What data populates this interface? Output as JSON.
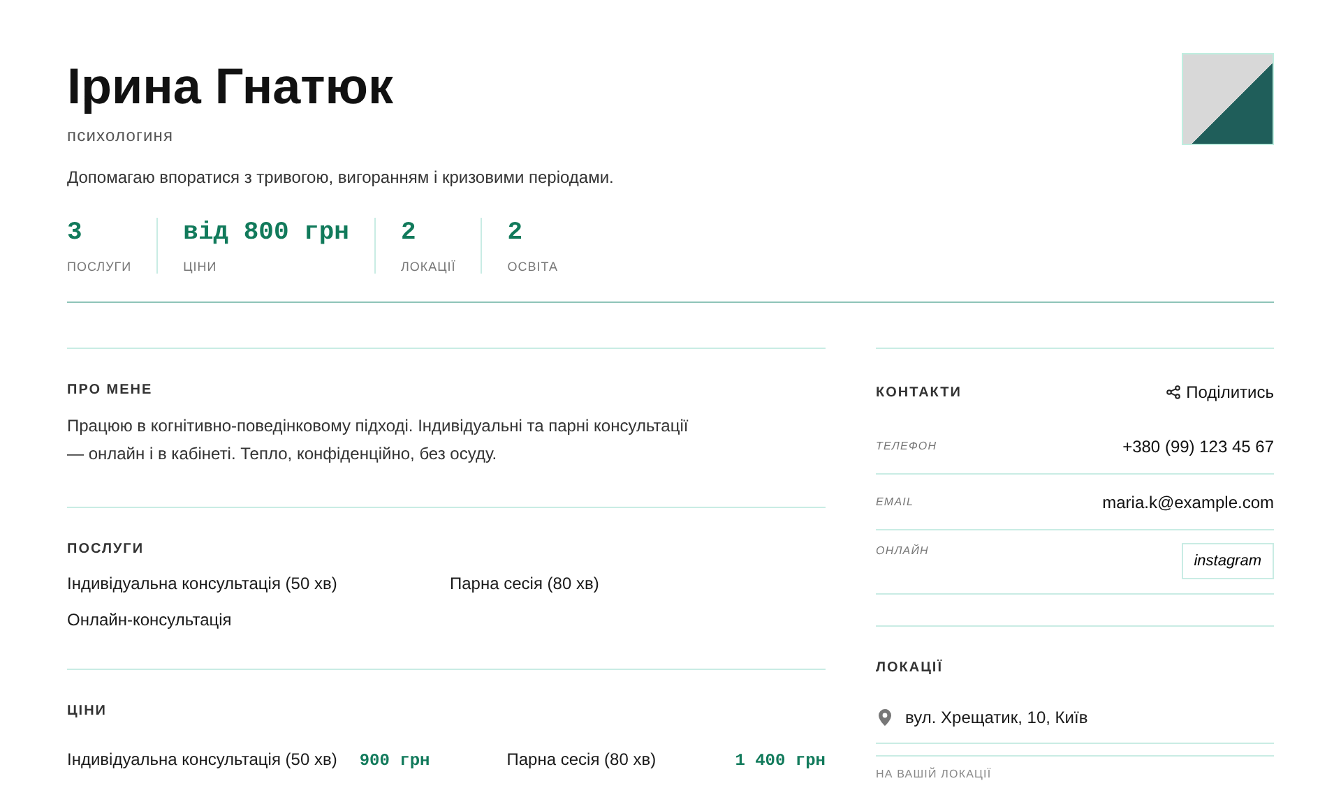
{
  "profile": {
    "name": "Ірина Гнатюк",
    "role": "психологиня",
    "tagline": "Допомагаю впоратися з тривогою, вигоранням і кризовими періодами."
  },
  "stats": [
    {
      "value": "3",
      "label": "ПОСЛУГИ"
    },
    {
      "value": "від 800 грн",
      "label": "ЦІНИ"
    },
    {
      "value": "2",
      "label": "ЛОКАЦІЇ"
    },
    {
      "value": "2",
      "label": "ОСВІТА"
    }
  ],
  "about": {
    "heading": "ПРО МЕНЕ",
    "text": "Працюю в когнітивно-поведінковому підході. Індивідуальні та парні консультації — онлайн і в кабінеті. Тепло, конфіденційно, без осуду."
  },
  "services": {
    "heading": "ПОСЛУГИ",
    "items": [
      "Індивідуальна консультація (50 хв)",
      "Парна сесія (80 хв)",
      "Онлайн-консультація"
    ]
  },
  "prices": {
    "heading": "ЦІНИ",
    "items": [
      {
        "name": "Індивідуальна консультація (50 хв)",
        "price": "900 грн"
      },
      {
        "name": "Парна сесія (80 хв)",
        "price": "1 400 грн"
      }
    ]
  },
  "contacts": {
    "heading": "КОНТАКТИ",
    "share": "Поділитись",
    "rows": [
      {
        "kind": "text",
        "label": "ТЕЛЕФОН",
        "value": "+380 (99) 123 45 67"
      },
      {
        "kind": "text",
        "label": "EMAIL",
        "value": "maria.k@example.com"
      },
      {
        "kind": "button",
        "label": "ОНЛАЙН",
        "value": "instagram"
      }
    ]
  },
  "locations": {
    "heading": "ЛОКАЦІЇ",
    "items": [
      "вул. Хрещатик, 10, Київ"
    ],
    "next_label": "НА ВАШІЙ ЛОКАЦІЇ"
  }
}
